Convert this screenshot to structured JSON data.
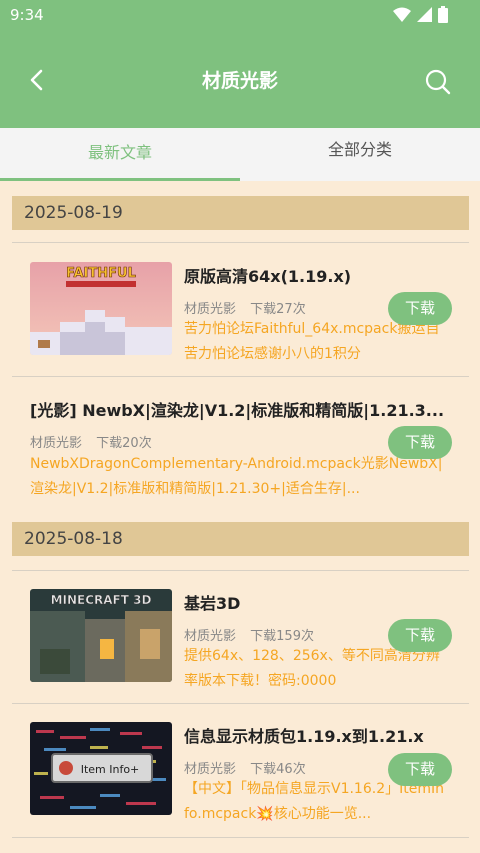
{
  "status": {
    "time": "9:34"
  },
  "header": {
    "title": "材质光影"
  },
  "tabs": [
    {
      "label": "最新文章"
    },
    {
      "label": "全部分类"
    }
  ],
  "groups": [
    {
      "date": "2025-08-19",
      "items": [
        {
          "title": "原版高清64x(1.19.x)",
          "category": "材质光影",
          "downloads": "下载27次",
          "desc": "苦力怕论坛Faithful_64x.mcpack搬运自苦力怕论坛感谢小八的1积分",
          "thumb_text": "FAITHFUL",
          "button": "下载"
        },
        {
          "title": "[光影] NewbX|渲染龙|V1.2|标准版和精简版|1.21.3...",
          "category": "材质光影",
          "downloads": "下载20次",
          "desc": "NewbXDragonComplementary-Android.mcpack光影NewbX|渲染龙|V1.2|标准版和精简版|1.21.30+|适合生存|...",
          "button": "下载"
        }
      ]
    },
    {
      "date": "2025-08-18",
      "items": [
        {
          "title": "基岩3D",
          "category": "材质光影",
          "downloads": "下载159次",
          "desc": "提供64x、128、256x、等不同高清分辨率版本下载！密码:0000",
          "thumb_text": "MINECRAFT 3D",
          "button": "下载"
        },
        {
          "title": "信息显示材质包1.19.x到1.21.x",
          "category": "材质光影",
          "downloads": "下载46次",
          "desc": "【中文】「物品信息显示V1.16.2」ItemInfo.mcpack💥核心功能一览...",
          "thumb_text": "Item Info+",
          "button": "下载"
        }
      ]
    }
  ],
  "colors": {
    "accent": "#7fc17f",
    "date_bar": "#e0c796",
    "desc": "#f5a623",
    "background": "#fbebd6"
  }
}
